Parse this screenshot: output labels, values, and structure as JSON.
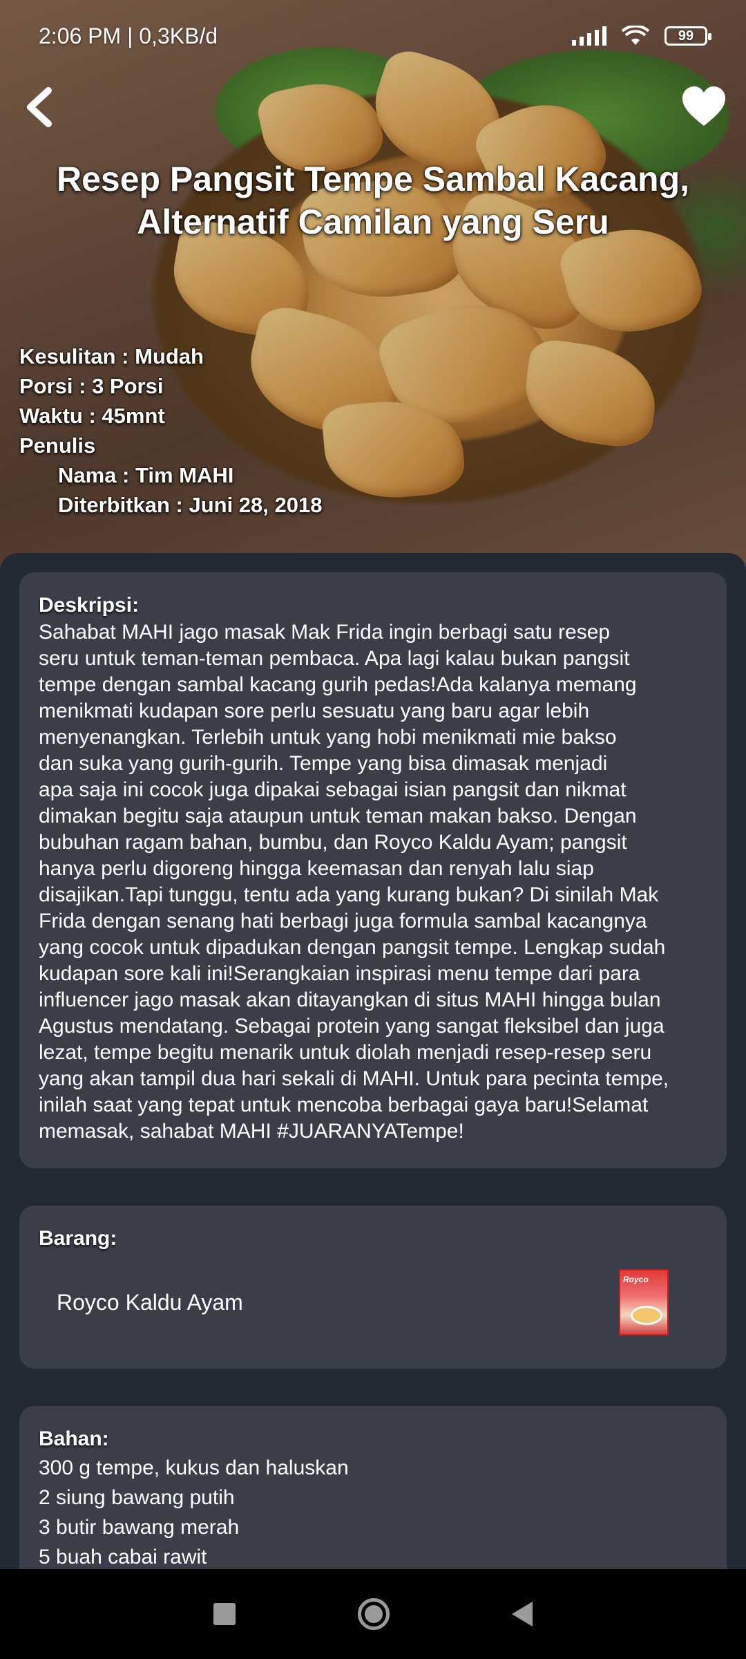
{
  "status_bar": {
    "time_speed": "2:06 PM | 0,3KB/d",
    "battery": "99"
  },
  "header": {
    "back_icon": "chevron-left-icon",
    "favorite_icon": "heart-icon",
    "title": "Resep Pangsit Tempe Sambal Kacang, Alternatif Camilan yang Seru"
  },
  "meta": {
    "difficulty": "Kesulitan : Mudah",
    "portion": "Porsi : 3 Porsi",
    "time": "Waktu : 45mnt",
    "author_label": "Penulis",
    "author_name": "Nama : Tim MAHI",
    "published": "Diterbitkan : Juni 28, 2018"
  },
  "description": {
    "heading": "Deskripsi:",
    "text": "Sahabat MAHI jago masak Mak Frida ingin berbagi satu resep\nseru untuk teman-teman pembaca. Apa lagi kalau bukan pangsit\ntempe dengan sambal kacang gurih pedas!Ada kalanya memang\nmenikmati kudapan sore perlu sesuatu yang baru agar lebih\nmenyenangkan. Terlebih untuk yang hobi menikmati mie bakso\ndan suka yang gurih-gurih. Tempe yang bisa dimasak menjadi\napa saja ini cocok juga dipakai sebagai isian pangsit dan nikmat\ndimakan begitu saja ataupun untuk teman makan bakso. Dengan\nbubuhan ragam bahan, bumbu, dan Royco Kaldu Ayam; pangsit\nhanya perlu digoreng hingga keemasan dan renyah lalu siap\ndisajikan.Tapi tunggu, tentu ada yang kurang bukan? Di sinilah Mak\nFrida dengan senang hati berbagi juga formula sambal kacangnya\nyang cocok untuk dipadukan dengan pangsit tempe. Lengkap sudah\nkudapan sore kali ini!Serangkaian inspirasi menu tempe dari para\ninfluencer jago masak akan ditayangkan di situs MAHI hingga bulan\nAgustus mendatang. Sebagai protein yang sangat fleksibel dan juga\nlezat, tempe begitu menarik untuk diolah menjadi resep-resep seru\nyang akan tampil dua hari sekali di MAHI. Untuk para pecinta tempe,\ninilah saat yang tepat untuk mencoba berbagai gaya baru!Selamat\nmemasak, sahabat MAHI #JUARANYATempe!"
  },
  "items": {
    "heading": "Barang:",
    "list": [
      {
        "name": "Royco Kaldu Ayam",
        "icon": "royco-product-image"
      }
    ]
  },
  "ingredients": {
    "heading": "Bahan:",
    "list": [
      "300 g tempe, kukus dan haluskan",
      "2 siung bawang putih",
      "3 butir bawang merah",
      "5 buah cabai rawit"
    ]
  },
  "navbar": {
    "recents_icon": "square-icon",
    "home_icon": "circle-home-icon",
    "back_icon": "triangle-back-icon"
  }
}
